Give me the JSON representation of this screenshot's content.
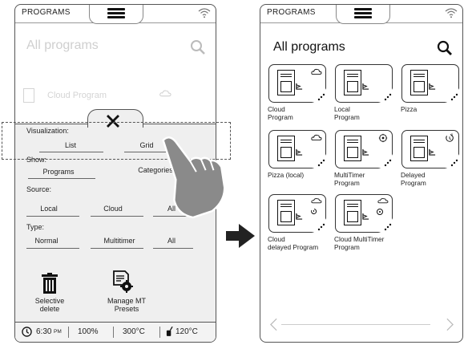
{
  "left": {
    "header_title": "PROGRAMS",
    "page_title": "All programs",
    "list_item": "Cloud Program",
    "visualization_label": "Visualization:",
    "visualization_options": [
      "List",
      "Grid"
    ],
    "show_label": "Show:",
    "show_options": [
      "Programs",
      "Categories"
    ],
    "source_label": "Source:",
    "source_options": [
      "Local",
      "Cloud",
      "All"
    ],
    "type_label": "Type:",
    "type_options": [
      "Normal",
      "Multitimer",
      "All"
    ],
    "actions": [
      {
        "label": "Selective\ndelete",
        "icon": "trash-icon"
      },
      {
        "label": "Manage MT\nPresets",
        "icon": "document-gear-icon"
      }
    ],
    "status": {
      "time": "6:30",
      "ampm": "PM",
      "power": "100%",
      "temp1": "300°C",
      "temp2": "120°C"
    }
  },
  "right": {
    "header_title": "PROGRAMS",
    "page_title": "All programs",
    "tiles": [
      {
        "label": "Cloud\nProgram",
        "badge": "cloud-icon"
      },
      {
        "label": "Local\nProgram",
        "badge": ""
      },
      {
        "label": "Pizza",
        "badge": ""
      },
      {
        "label": "Pizza (local)",
        "badge": "cloud-icon"
      },
      {
        "label": "MultiTimer\nProgram",
        "badge": "multitimer-icon"
      },
      {
        "label": "Delayed\nProgram",
        "badge": "delay-clock-icon"
      },
      {
        "label": "Cloud\ndelayed Program",
        "badge": "cloud-delay-icon"
      },
      {
        "label": "Cloud MultiTimer\nProgram",
        "badge": "cloud-multitimer-icon"
      }
    ]
  },
  "colors": {
    "border": "#555555",
    "overlay": "#ebebeb",
    "arrow": "#222222",
    "hand": "#8a8a8a"
  }
}
